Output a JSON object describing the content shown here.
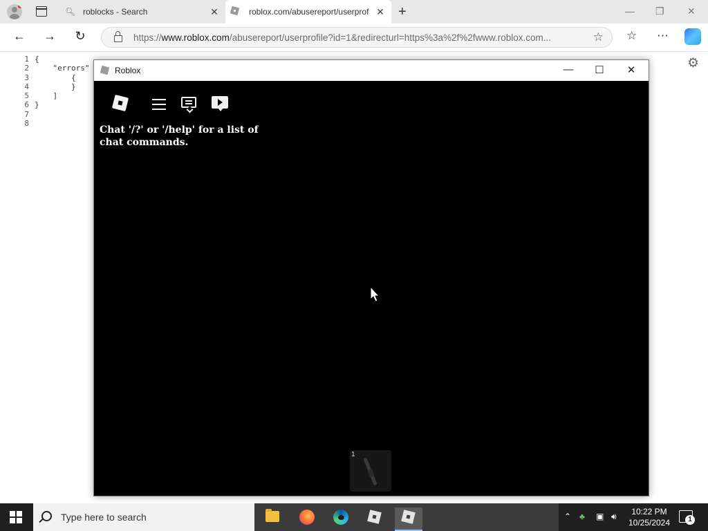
{
  "browser": {
    "tabs": [
      {
        "title": "roblocks - Search",
        "icon": "search-icon"
      },
      {
        "title": "roblox.com/abusereport/userprof",
        "icon": "roblox-favicon"
      }
    ],
    "address": {
      "url_prefix": "https://",
      "url_host": "www.roblox.com",
      "url_path": "/abusereport/userprofile?id=1&redirecturl=https%3a%2f%2fwww.roblox.com..."
    }
  },
  "page": {
    "line_numbers": [
      "1",
      "2",
      "3",
      "4",
      "5",
      "6",
      "7",
      "8"
    ],
    "code_lines": [
      "{",
      "    \"errors\"",
      "        {",
      "",
      "",
      "        }",
      "    ]",
      "}"
    ]
  },
  "game_window": {
    "title": "Roblox",
    "chat_message": "Chat '/?' or '/help' for a list of chat commands.",
    "hotbar_slot_number": "1"
  },
  "taskbar": {
    "search_placeholder": "Type here to search",
    "time": "10:22 PM",
    "date": "10/25/2024",
    "notification_count": "1"
  }
}
